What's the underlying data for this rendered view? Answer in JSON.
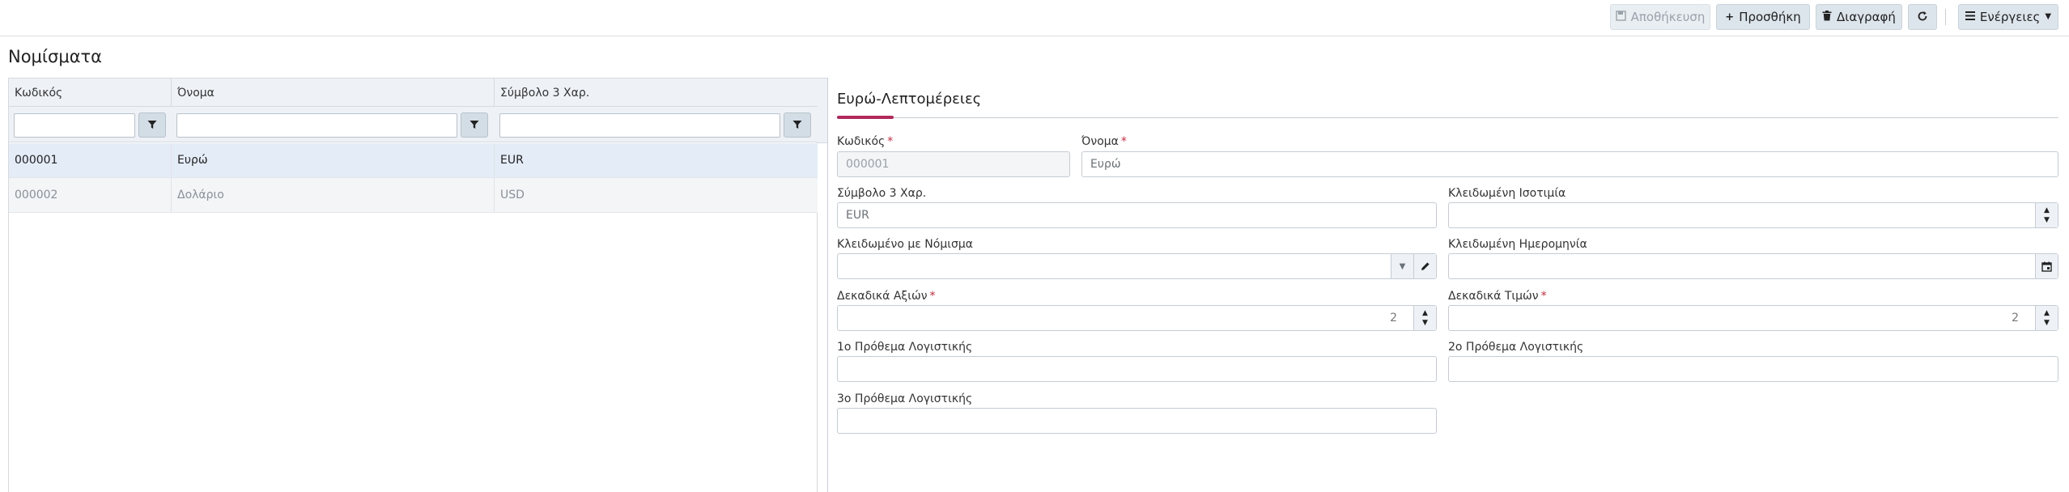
{
  "toolbar": {
    "save_label": "Αποθήκευση",
    "add_label": "Προσθήκη",
    "delete_label": "Διαγραφή",
    "actions_label": "Ενέργειες"
  },
  "page": {
    "title": "Νομίσματα"
  },
  "grid": {
    "columns": [
      "Κωδικός",
      "Όνομα",
      "Σύμβολο 3 Χαρ."
    ],
    "rows": [
      {
        "code": "000001",
        "name": "Ευρώ",
        "symbol": "EUR"
      },
      {
        "code": "000002",
        "name": "Δολάριο",
        "symbol": "USD"
      }
    ]
  },
  "detail": {
    "title": "Ευρώ-Λεπτομέρειες",
    "fields": {
      "code": {
        "label": "Κωδικός",
        "value": "000001"
      },
      "name": {
        "label": "Όνομα",
        "value": "Ευρώ"
      },
      "symbol": {
        "label": "Σύμβολο 3 Χαρ.",
        "value": "EUR"
      },
      "locked_parity": {
        "label": "Κλειδωμένη Ισοτιμία",
        "value": ""
      },
      "locked_currency": {
        "label": "Κλειδωμένο με Νόμισμα",
        "value": ""
      },
      "locked_date": {
        "label": "Κλειδωμένη Ημερομηνία",
        "value": ""
      },
      "amount_decimals": {
        "label": "Δεκαδικά Αξιών",
        "value": "2"
      },
      "price_decimals": {
        "label": "Δεκαδικά Τιμών",
        "value": "2"
      },
      "prefix1": {
        "label": "1ο Πρόθεμα Λογιστικής",
        "value": ""
      },
      "prefix2": {
        "label": "2ο Πρόθεμα Λογιστικής",
        "value": ""
      },
      "prefix3": {
        "label": "3ο Πρόθεμα Λογιστικής",
        "value": ""
      }
    }
  },
  "colors": {
    "accent": "#b3285b",
    "required": "#d0263b",
    "selected_row": "#e4ecf7"
  }
}
